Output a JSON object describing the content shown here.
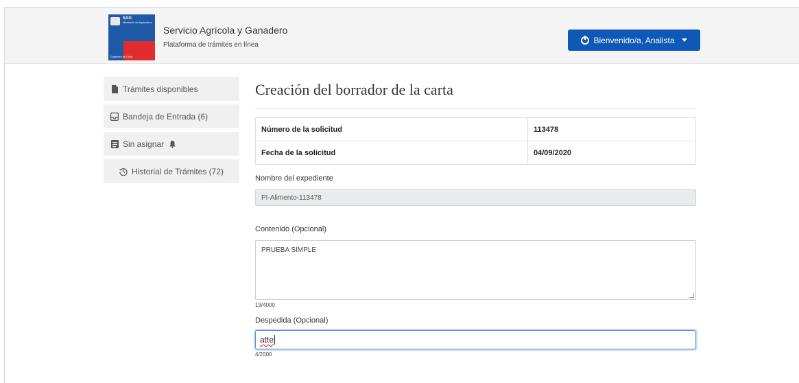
{
  "header": {
    "logo": {
      "sag": "SAG",
      "ministry": "Ministerio de Agricultura",
      "government": "Gobierno de Chile"
    },
    "title": "Servicio Agrícola y Ganadero",
    "subtitle": "Plataforma de trámites en línea",
    "user_button": "Bienvenido/a, Analista",
    "user_button_color": "#0d59b5"
  },
  "sidebar": {
    "items": [
      {
        "label": "Trámites disponibles",
        "icon": "file-icon"
      },
      {
        "label": "Bandeja de Entrada (6)",
        "icon": "inbox-icon"
      },
      {
        "label": "Sin asignar",
        "icon": "list-icon",
        "badge_icon": "bell-icon"
      },
      {
        "label": "Historial de Trámites (72)",
        "icon": "history-icon"
      }
    ]
  },
  "main": {
    "title": "Creación del borrador de la carta",
    "info_table": [
      {
        "label": "Número de la solicitud",
        "value": "113478"
      },
      {
        "label": "Fecha de la solicitud",
        "value": "04/09/2020"
      }
    ],
    "expediente": {
      "label": "Nombre del expediente",
      "value": "PI-Alimento-113478"
    },
    "contenido": {
      "label": "Contenido (Opcional)",
      "value": "PRUEBA SIMPLE",
      "counter": "13/4000"
    },
    "despedida": {
      "label": "Despedida (Opcional)",
      "value": "atte",
      "counter": "4/2000"
    }
  }
}
